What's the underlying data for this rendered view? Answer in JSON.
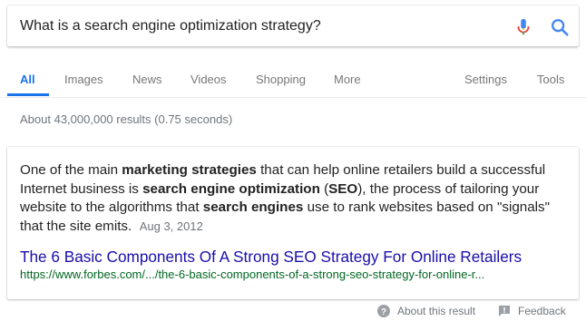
{
  "search": {
    "query": "What is a search engine optimization strategy?"
  },
  "tabs": {
    "all": "All",
    "images": "Images",
    "news": "News",
    "videos": "Videos",
    "shopping": "Shopping",
    "more": "More",
    "settings": "Settings",
    "tools": "Tools"
  },
  "result_stats": "About 43,000,000 results (0.75 seconds)",
  "snippet": {
    "t1": "One of the main ",
    "b1": "marketing strategies",
    "t2": " that can help online retailers build a successful Internet business is ",
    "b2": "search engine optimization",
    "t3": " (",
    "b3": "SEO",
    "t4": "), the process of tailoring your website to the algorithms that ",
    "b4": "search engines",
    "t5": " use to rank websites based on \"signals\" that the site emits.",
    "date": "Aug 3, 2012",
    "title": "The 6 Basic Components Of A Strong SEO Strategy For Online Retailers",
    "url": "https://www.forbes.com/.../the-6-basic-components-of-a-strong-seo-strategy-for-online-r..."
  },
  "footer": {
    "about": "About this result",
    "feedback": "Feedback"
  },
  "icons": {
    "mic": "mic-icon",
    "search": "search-icon",
    "help": "help-circle-icon",
    "feedback": "feedback-icon"
  },
  "colors": {
    "accent": "#1a73e8",
    "link": "#1a0dab",
    "url": "#006621"
  }
}
